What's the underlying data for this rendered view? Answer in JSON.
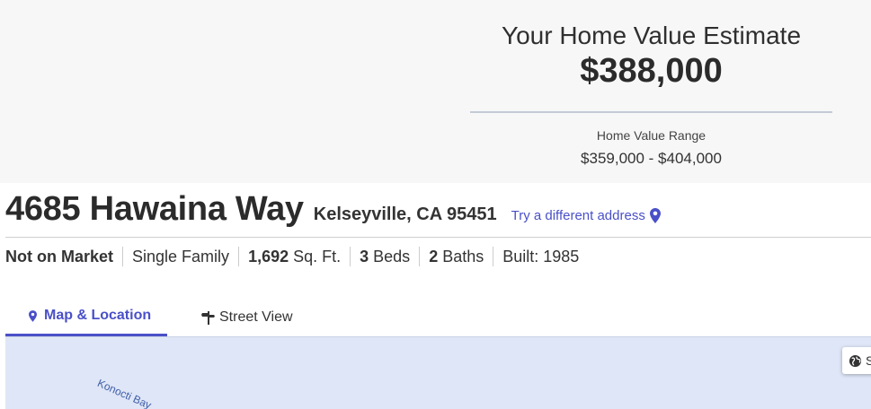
{
  "estimate": {
    "heading": "Your Home Value Estimate",
    "value": "$388,000",
    "range_label": "Home Value Range",
    "range_value": "$359,000 - $404,000"
  },
  "address": {
    "street": "4685 Hawaina Way",
    "city_state_zip": "Kelseyville, CA 95451",
    "different_address_link": "Try a different address"
  },
  "facts": {
    "status": "Not on Market",
    "property_type": "Single Family",
    "sqft_value": "1,692",
    "sqft_unit": " Sq. Ft.",
    "beds_value": "3",
    "beds_unit": " Beds",
    "baths_value": "2",
    "baths_unit": " Baths",
    "built": "Built: 1985"
  },
  "tabs": {
    "map_label": "Map & Location",
    "street_label": "Street View"
  },
  "map": {
    "road_label": "Konocti Bay",
    "control_label": "S"
  },
  "colors": {
    "accent": "#4a50c8",
    "band_background": "#f7f7f7",
    "map_water": "#dfe6f7"
  },
  "icons": {
    "location_pin": "map-pin-icon",
    "street_view": "signpost-icon",
    "globe": "globe-icon"
  }
}
